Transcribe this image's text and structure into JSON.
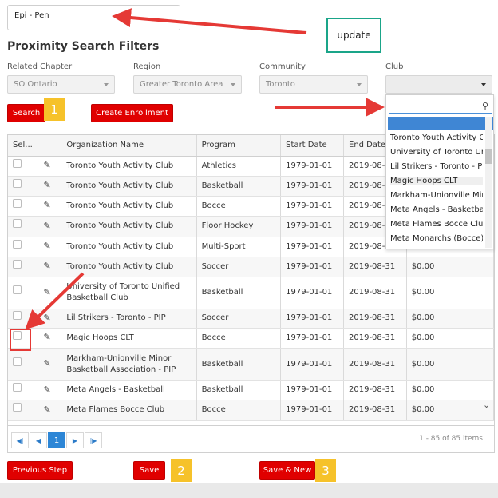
{
  "top_input": {
    "value": "Epi - Pen"
  },
  "annotation": {
    "update_label": "update"
  },
  "page_title": "Proximity Search Filters",
  "filters": {
    "related_chapter": {
      "label": "Related Chapter",
      "value": "SO Ontario"
    },
    "region": {
      "label": "Region",
      "value": "Greater Toronto Area"
    },
    "community": {
      "label": "Community",
      "value": "Toronto"
    },
    "club": {
      "label": "Club",
      "value": ""
    }
  },
  "buttons": {
    "search": "Search",
    "create_enrollment": "Create Enrollment",
    "previous_step": "Previous Step",
    "save": "Save",
    "save_new": "Save & New"
  },
  "badges": {
    "one": "1",
    "two": "2",
    "three": "3"
  },
  "table": {
    "columns": [
      "Sel...",
      "",
      "Organization Name",
      "Program",
      "Start Date",
      "End Date",
      ""
    ],
    "rows": [
      {
        "org": "Toronto Youth Activity Club",
        "program": "Athletics",
        "start": "1979-01-01",
        "end": "2019-08-31",
        "fee": ""
      },
      {
        "org": "Toronto Youth Activity Club",
        "program": "Basketball",
        "start": "1979-01-01",
        "end": "2019-08-31",
        "fee": ""
      },
      {
        "org": "Toronto Youth Activity Club",
        "program": "Bocce",
        "start": "1979-01-01",
        "end": "2019-08-31",
        "fee": ""
      },
      {
        "org": "Toronto Youth Activity Club",
        "program": "Floor Hockey",
        "start": "1979-01-01",
        "end": "2019-08-31",
        "fee": ""
      },
      {
        "org": "Toronto Youth Activity Club",
        "program": "Multi-Sport",
        "start": "1979-01-01",
        "end": "2019-08-31",
        "fee": ""
      },
      {
        "org": "Toronto Youth Activity Club",
        "program": "Soccer",
        "start": "1979-01-01",
        "end": "2019-08-31",
        "fee": "$0.00"
      },
      {
        "org": "University of Toronto Unified Basketball Club",
        "program": "Basketball",
        "start": "1979-01-01",
        "end": "2019-08-31",
        "fee": "$0.00"
      },
      {
        "org": "Lil Strikers - Toronto - PIP",
        "program": "Soccer",
        "start": "1979-01-01",
        "end": "2019-08-31",
        "fee": "$0.00"
      },
      {
        "org": "Magic Hoops CLT",
        "program": "Bocce",
        "start": "1979-01-01",
        "end": "2019-08-31",
        "fee": "$0.00"
      },
      {
        "org": "Markham-Unionville Minor Basketball Association - PIP",
        "program": "Basketball",
        "start": "1979-01-01",
        "end": "2019-08-31",
        "fee": "$0.00"
      },
      {
        "org": "Meta Angels - Basketball",
        "program": "Basketball",
        "start": "1979-01-01",
        "end": "2019-08-31",
        "fee": "$0.00"
      },
      {
        "org": "Meta Flames Bocce Club",
        "program": "Bocce",
        "start": "1979-01-01",
        "end": "2019-08-31",
        "fee": "$0.00"
      }
    ]
  },
  "pager": {
    "current_page": "1",
    "items_info": "1 - 85 of 85 items"
  },
  "club_dropdown": {
    "options": [
      "Toronto Youth Activity Club",
      "University of Toronto Unified",
      "Lil Strikers - Toronto - PIP",
      "Magic Hoops CLT",
      "Markham-Unionville Minor",
      "Meta Angels - Basketball",
      "Meta Flames Bocce Club",
      "Meta Monarchs (Bocce)"
    ]
  },
  "colors": {
    "accent_red": "#e00000",
    "badge_yellow": "#f6c22a",
    "teal": "#1aa589",
    "blue": "#3f86d4"
  }
}
